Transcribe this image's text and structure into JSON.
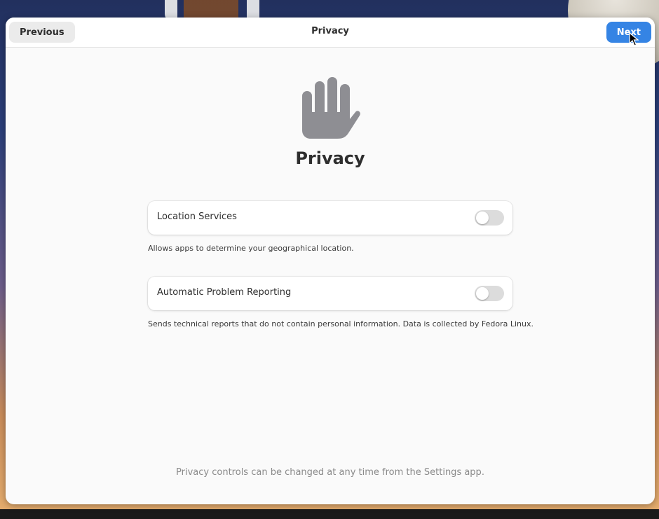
{
  "header": {
    "title": "Privacy",
    "previous_label": "Previous",
    "next_label": "Next"
  },
  "hero": {
    "icon": "raised-hand-icon",
    "title": "Privacy"
  },
  "settings": [
    {
      "label": "Location Services",
      "description": "Allows apps to determine your geographical location.",
      "enabled": false
    },
    {
      "label": "Automatic Problem Reporting",
      "description": "Sends technical reports that do not contain personal information. Data is collected by Fedora Linux.",
      "enabled": false
    }
  ],
  "footer_note": "Privacy controls can be changed at any time from the Settings app.",
  "colors": {
    "accent": "#3584e4",
    "icon": "#8e8e93",
    "switch_off": "#dcdcdc"
  }
}
